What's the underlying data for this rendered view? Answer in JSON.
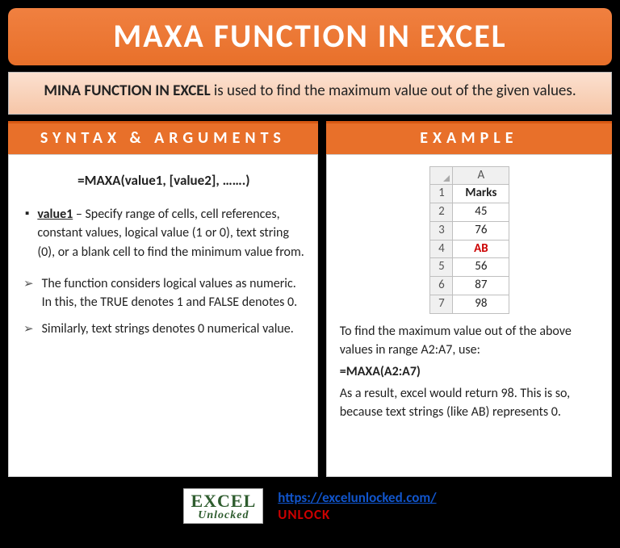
{
  "title": "MAXA FUNCTION IN EXCEL",
  "description": {
    "bold": "MINA FUNCTION IN EXCEL",
    "rest": " is used to find the maximum value out of the given values."
  },
  "sections": {
    "syntax_header": "SYNTAX & ARGUMENTS",
    "example_header": "EXAMPLE"
  },
  "syntax": {
    "formula": "=MAXA(value1, [value2], …….)",
    "arg_name": "value1",
    "arg_desc": " – Specify range of cells, cell references, constant values, logical value (1 or 0), text string (0), or a blank cell to find the minimum value from.",
    "note1": "The function considers logical values as numeric. In this, the TRUE denotes 1 and FALSE denotes 0.",
    "note2": "Similarly, text strings denotes 0 numerical value."
  },
  "example": {
    "col_header": "A",
    "rows": [
      {
        "n": "1",
        "v": "Marks"
      },
      {
        "n": "2",
        "v": "45"
      },
      {
        "n": "3",
        "v": "76"
      },
      {
        "n": "4",
        "v": "AB"
      },
      {
        "n": "5",
        "v": "56"
      },
      {
        "n": "6",
        "v": "87"
      },
      {
        "n": "7",
        "v": "98"
      }
    ],
    "text1": "To find the maximum value out of the above values in range A2:A7, use:",
    "formula": "=MAXA(A2:A7)",
    "text2": "As a result, excel would return 98. This is so, because text strings (like AB) represents 0."
  },
  "footer": {
    "logo_top_pre": "E",
    "logo_top_post": "CEL",
    "logo_x": "X",
    "logo_bottom": "Unlocked",
    "link": "https://excelunlocked.com/",
    "unlock": "UNLOCK"
  }
}
